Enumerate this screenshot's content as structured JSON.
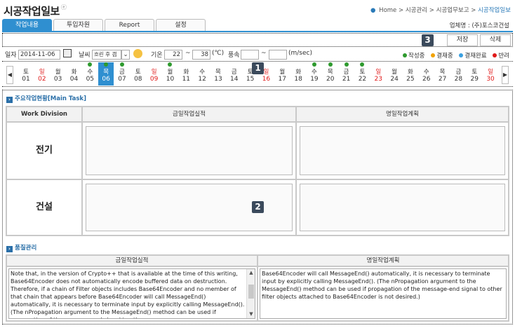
{
  "header": {
    "title": "시공작업일보",
    "title_mark": "ⓔ",
    "breadcrumb": [
      "Home",
      "시공관리",
      "시공업무보고",
      "시공작업일보"
    ],
    "company": "업체명 : (주)포스코건설"
  },
  "tabs": [
    "작업내용",
    "투입자원",
    "Report",
    "설정"
  ],
  "actions": {
    "save": "저장",
    "delete": "삭제"
  },
  "badges": [
    "1",
    "2",
    "3"
  ],
  "filters": {
    "date_label": "일자",
    "date_value": "2014-11-06",
    "weather_label": "날씨",
    "weather_value": "흐린 후 갬",
    "temp_label": "기온",
    "temp_min": "22",
    "temp_sep": "~",
    "temp_max": "38",
    "temp_unit": "(℃)",
    "wind_label": "풍속",
    "wind_min": "",
    "wind_sep": "~",
    "wind_max": "",
    "wind_unit": "(m/sec)"
  },
  "legend": [
    {
      "label": "작성중",
      "color": "#2e9a2e"
    },
    {
      "label": "결재중",
      "color": "#f2a200"
    },
    {
      "label": "결재완료",
      "color": "#3aa0e0"
    },
    {
      "label": "반려",
      "color": "#e01919"
    }
  ],
  "calendar": [
    {
      "w": "토",
      "n": "01",
      "red": false,
      "dot": false
    },
    {
      "w": "일",
      "n": "02",
      "red": true,
      "dot": false
    },
    {
      "w": "월",
      "n": "03",
      "red": false,
      "dot": false
    },
    {
      "w": "화",
      "n": "04",
      "red": false,
      "dot": false
    },
    {
      "w": "수",
      "n": "05",
      "red": false,
      "dot": true
    },
    {
      "w": "목",
      "n": "06",
      "red": false,
      "dot": true,
      "sel": true
    },
    {
      "w": "금",
      "n": "07",
      "red": false,
      "dot": true
    },
    {
      "w": "토",
      "n": "08",
      "red": false,
      "dot": false
    },
    {
      "w": "일",
      "n": "09",
      "red": true,
      "dot": false
    },
    {
      "w": "월",
      "n": "10",
      "red": false,
      "dot": true
    },
    {
      "w": "화",
      "n": "11",
      "red": false,
      "dot": false
    },
    {
      "w": "수",
      "n": "12",
      "red": false,
      "dot": false
    },
    {
      "w": "목",
      "n": "13",
      "red": false,
      "dot": false
    },
    {
      "w": "금",
      "n": "14",
      "red": false,
      "dot": false
    },
    {
      "w": "토",
      "n": "15",
      "red": false,
      "dot": false
    },
    {
      "w": "일",
      "n": "16",
      "red": true,
      "dot": false
    },
    {
      "w": "월",
      "n": "17",
      "red": false,
      "dot": false
    },
    {
      "w": "화",
      "n": "18",
      "red": false,
      "dot": false
    },
    {
      "w": "수",
      "n": "19",
      "red": false,
      "dot": true
    },
    {
      "w": "목",
      "n": "20",
      "red": false,
      "dot": true
    },
    {
      "w": "금",
      "n": "21",
      "red": false,
      "dot": true
    },
    {
      "w": "토",
      "n": "22",
      "red": false,
      "dot": true
    },
    {
      "w": "일",
      "n": "23",
      "red": true,
      "dot": false
    },
    {
      "w": "월",
      "n": "24",
      "red": false,
      "dot": false
    },
    {
      "w": "화",
      "n": "25",
      "red": false,
      "dot": false
    },
    {
      "w": "수",
      "n": "26",
      "red": false,
      "dot": false
    },
    {
      "w": "목",
      "n": "27",
      "red": false,
      "dot": false
    },
    {
      "w": "금",
      "n": "28",
      "red": false,
      "dot": false
    },
    {
      "w": "토",
      "n": "29",
      "red": false,
      "dot": false
    },
    {
      "w": "일",
      "n": "30",
      "red": true,
      "dot": false
    }
  ],
  "main_task": {
    "title": "주요작업현황[Main Task]",
    "col_division": "Work Division",
    "col_today": "금일작업실적",
    "col_tomorrow": "명일작업계획",
    "rows": [
      "전기",
      "건설"
    ]
  },
  "quality": {
    "title": "품질관리",
    "col_today": "금일작업실적",
    "col_tomorrow": "명일작업계획",
    "today_text": "Note that, in the version of Crypto++ that is available at the time of this writing, Base64Encoder does not automatically encode buffered data on destruction. Therefore, if a chain of Filter objects includes Base64Encoder and no member of that chain that appears before Base64Encoder will call MessageEnd() automatically, it is necessary to terminate input by explicitly calling MessageEnd(). (The nPropagation argument to the MessageEnd() method can be used if propagation of the message-end signal to other",
    "tomorrow_text": "Base64Encoder will call MessageEnd() automatically, it is necessary to terminate input by explicitly calling MessageEnd(). (The nPropagation argument to the MessageEnd() method can be used if propagation of the message-end signal to other filter objects attached to Base64Encoder is not desired.)"
  }
}
